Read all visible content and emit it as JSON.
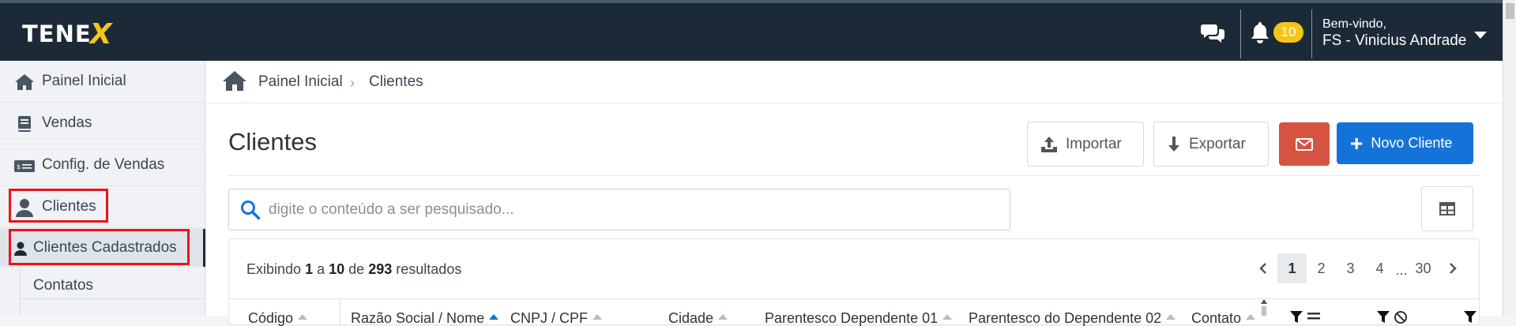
{
  "app": {
    "logo": "TENEX",
    "logo_main": "TENE",
    "logo_accent": "X"
  },
  "header": {
    "chat_icon": "comments-icon",
    "bell_icon": "bell-icon",
    "notifications_count": "10",
    "welcome": "Bem-vindo,",
    "user_name": "FS - Vinicius Andrade",
    "colors": {
      "bg": "#1c2a38",
      "badge": "#f5c518"
    }
  },
  "sidebar": {
    "items": [
      {
        "label": "Painel Inicial",
        "icon": "home-icon"
      },
      {
        "label": "Vendas",
        "icon": "book-icon"
      },
      {
        "label": "Config. de Vendas",
        "icon": "money-bill-icon"
      },
      {
        "label": "Clientes",
        "icon": "user-icon"
      }
    ],
    "subitems": [
      {
        "label": "Clientes Cadastrados",
        "icon": "user-icon",
        "active": true
      },
      {
        "label": "Contatos"
      }
    ]
  },
  "breadcrumb": {
    "home": "Painel Inicial",
    "current": "Clientes"
  },
  "page": {
    "title": "Clientes"
  },
  "toolbar": {
    "import_label": "Importar",
    "export_label": "Exportar",
    "email_icon": "envelope-icon",
    "new_label": "Novo Cliente",
    "colors": {
      "email": "#d65241",
      "primary": "#1473d9"
    }
  },
  "search": {
    "placeholder": "digite o conteúdo a ser pesquisado...",
    "value": ""
  },
  "results": {
    "prefix": "Exibindo",
    "from": "1",
    "a": "a",
    "to": "10",
    "de": "de",
    "total": "293",
    "suffix": "resultados"
  },
  "pagination": {
    "pages": [
      "1",
      "2",
      "3",
      "4"
    ],
    "ellipsis": "...",
    "last": "30",
    "current": "1"
  },
  "table": {
    "columns": [
      "Código",
      "Razão Social / Nome",
      "CNPJ / CPF",
      "Cidade",
      "Parentesco Dependente 01",
      "Parentesco do Dependente 02",
      "Contato"
    ]
  }
}
